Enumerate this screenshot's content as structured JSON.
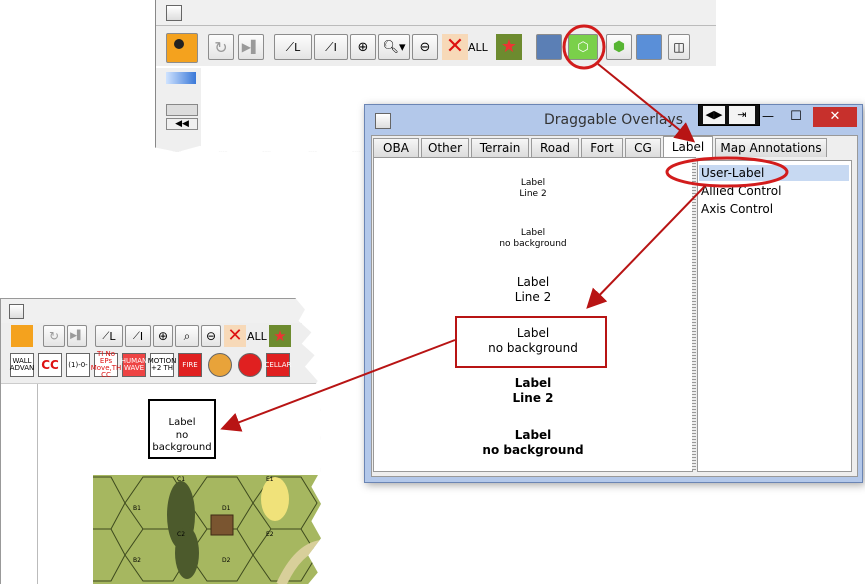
{
  "top_window": {
    "toolbar": {
      "line_l_label": "L",
      "line_i_label": "I",
      "all_label": "ALL"
    }
  },
  "overlay_window": {
    "title": "Draggable Overlays",
    "controls": {
      "minimize": "—",
      "maximize": "☐",
      "close": "✕"
    },
    "tabs": [
      "OBA",
      "Other",
      "Terrain",
      "Road",
      "Fort",
      "CG",
      "Label",
      "Map Annotations"
    ],
    "selected_tab": "Label",
    "previews": [
      {
        "line1": "Label",
        "line2": "Line 2"
      },
      {
        "line1": "Label",
        "line2": "no background"
      },
      {
        "line1": "Label",
        "line2": "Line 2"
      },
      {
        "line1": "Label",
        "line2": "no background"
      },
      {
        "line1": "Label",
        "line2": "Line 2"
      },
      {
        "line1": "Label",
        "line2": "no background"
      }
    ],
    "list": [
      "User-Label",
      "Allied Control",
      "Axis Control"
    ]
  },
  "left_window": {
    "toolbar": {
      "line_l_label": "L",
      "line_i_label": "I",
      "all_label": "ALL"
    },
    "counters": [
      "WALL ADVAN",
      "CC",
      "(1)-0-",
      "TI No EPs Move,TH CC",
      "HUMAN WAVE",
      "MOTION +2 TH",
      "FIRE",
      "",
      "",
      "CELLAR"
    ],
    "map_label": {
      "line1": "Label",
      "line2": "no background"
    },
    "hex_labels": [
      "C1",
      "D1",
      "E1",
      "B1",
      "B2",
      "C2",
      "D2",
      "E2"
    ]
  },
  "colors": {
    "window_title_bg": "#b3c8ea",
    "close_red": "#c7302c",
    "annotation_red": "#b81414",
    "map_green": "#a6b760",
    "highlight_blue": "#c7d9f2"
  }
}
